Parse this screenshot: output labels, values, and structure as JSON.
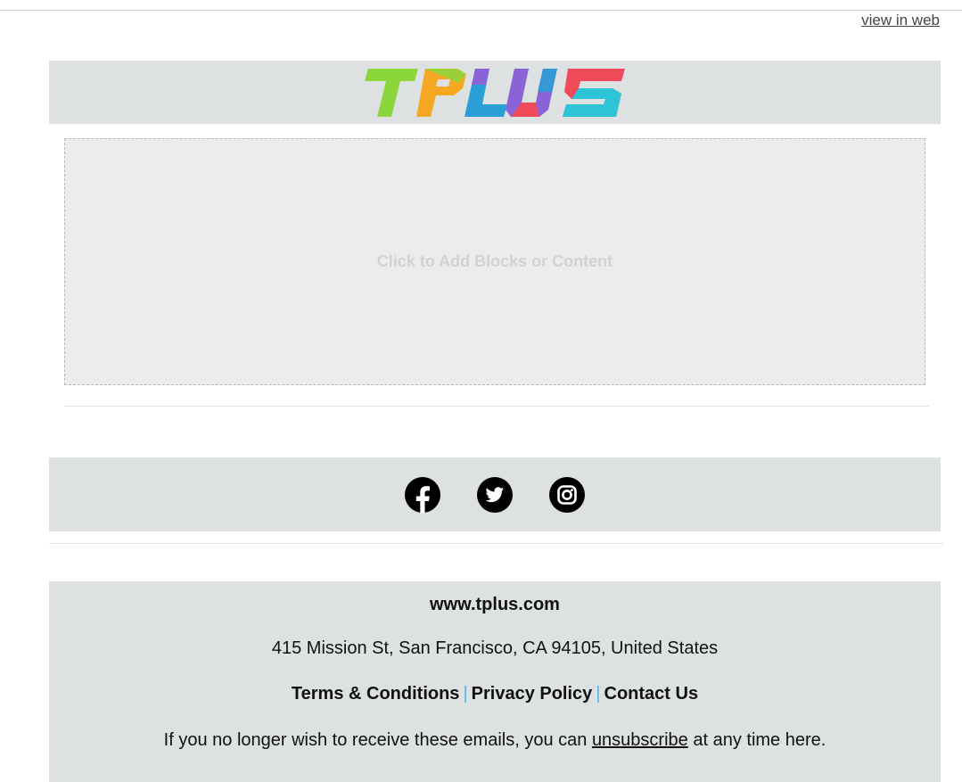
{
  "header": {
    "view_in_web": "view in web"
  },
  "logo": {
    "text": "TPLUS"
  },
  "content_area": {
    "placeholder": "Click to Add Blocks or Content"
  },
  "social": {
    "icons": [
      "facebook-icon",
      "twitter-icon",
      "instagram-icon"
    ]
  },
  "footer": {
    "website": "www.tplus.com",
    "address": "415 Mission St, San Francisco, CA 94105, United States",
    "links": {
      "terms": "Terms & Conditions",
      "separator": "|",
      "privacy": "Privacy Policy",
      "contact": "Contact Us"
    },
    "unsubscribe": {
      "prefix": "If you no longer wish to receive these emails, you can",
      "link": "unsubscribe",
      "suffix": "at any time here."
    }
  },
  "colors": {
    "band_bg": "#dde1e2",
    "placeholder_bg": "#ececec",
    "link_separator": "#5bb5d6",
    "logo_green": "#8bd63b",
    "logo_orange": "#f7a823",
    "logo_purple": "#8a64d6",
    "logo_blue": "#2a9fd6",
    "logo_red": "#f04b5a",
    "logo_cyan": "#2cc4d6"
  }
}
